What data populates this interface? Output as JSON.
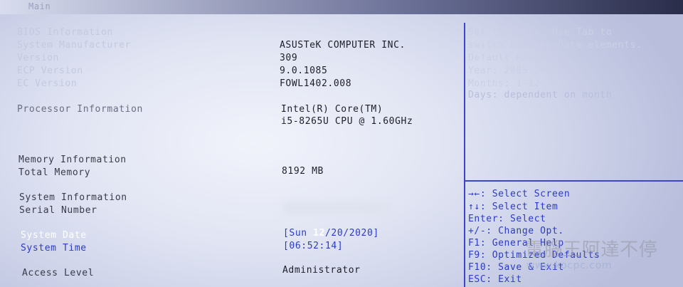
{
  "header": {
    "title": "Main"
  },
  "bios": {
    "section_info": "BIOS Information",
    "manufacturer_label": "System Manufacturer",
    "manufacturer_value": "ASUSTeK COMPUTER INC.",
    "version_label": "Version",
    "version_value": "309",
    "ecp_label": "ECP Version",
    "ecp_value": "9.0.1085",
    "ec_label": "EC Version",
    "ec_value": "FOWL1402.008"
  },
  "processor": {
    "label": "Processor Information",
    "line1": "Intel(R) Core(TM)",
    "line2": "i5-8265U CPU @ 1.60GHz"
  },
  "memory": {
    "section": "Memory Information",
    "total_label": "Total Memory",
    "total_value": "8192 MB"
  },
  "system": {
    "section": "System Information",
    "serial_label": "Serial Number"
  },
  "date": {
    "label": "System Date",
    "open": "[Sun ",
    "month_selected": "12",
    "rest": "/20/2020]"
  },
  "time": {
    "label": "System Time",
    "value": "[06:52:14]"
  },
  "access": {
    "label": "Access Level",
    "value": "Administrator"
  },
  "help_text": [
    "Set the Date. Use Tab to",
    "switch between Date elements.",
    "Default Ranges:",
    "Year: 2005-2099",
    "Months: 1-12",
    "Days: dependent on month"
  ],
  "keys": [
    "→←: Select Screen",
    "↑↓: Select Item",
    "Enter: Select",
    "+/-: Change Opt.",
    "F1: General Help",
    "F9: Optimized Defaults",
    "F10: Save & Exit",
    "ESC: Exit"
  ],
  "watermark": {
    "text": "電腦王阿達不停",
    "sub": "www.kocpc.com"
  },
  "colors": {
    "accent": "#2c3bc4",
    "divider": "#3b46c8",
    "selected": "#ffffff"
  }
}
